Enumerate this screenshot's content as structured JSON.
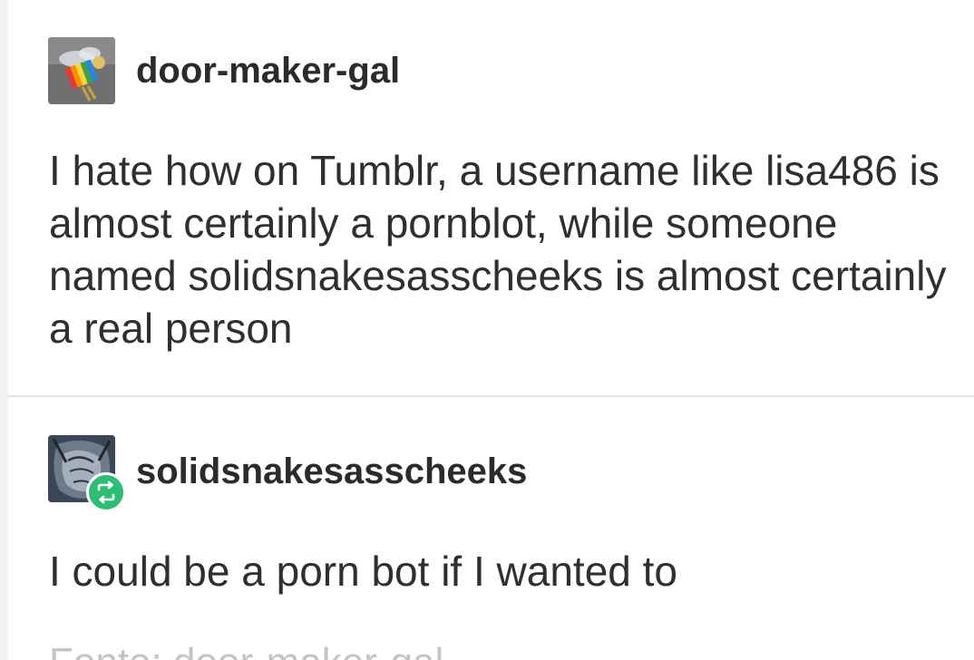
{
  "posts": [
    {
      "username": "door-maker-gal",
      "avatar_icon": "rainbow-bee-avatar",
      "text": "I hate how on Tumblr, a username like lisa486 is almost certainly a pornblot, while someone named solidsnakesasscheeks is almost certainly a real person"
    },
    {
      "username": "solidsnakesasscheeks",
      "avatar_icon": "sketch-avatar",
      "badge_icon": "reblog-icon",
      "text": "I could be a porn bot if I wanted to"
    }
  ],
  "footer": {
    "source_text": "Fonte: door-maker-gal"
  },
  "colors": {
    "reblog_badge": "#2dbe73",
    "username": "#2b2b2b",
    "body_text": "#2f2f2f",
    "divider": "#e3e3e3"
  }
}
